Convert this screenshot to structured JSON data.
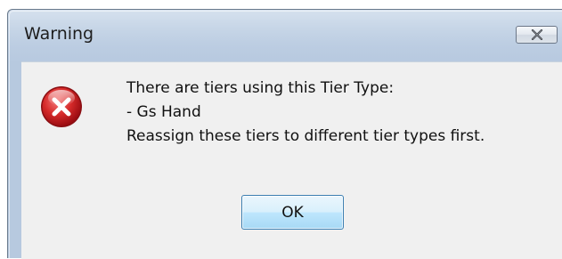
{
  "window": {
    "title": "Warning",
    "close_icon": "close-icon"
  },
  "dialog": {
    "icon": "error-icon",
    "message_lines": [
      "There are tiers using this Tier Type:",
      "- Gs Hand",
      "Reassign these tiers to different tier types first."
    ],
    "ok_label": "OK"
  },
  "colors": {
    "title_bar": "#c7d6e7",
    "content_background": "#f0f0f0",
    "error_red": "#c8141c",
    "button_border": "#3c7fb1"
  }
}
